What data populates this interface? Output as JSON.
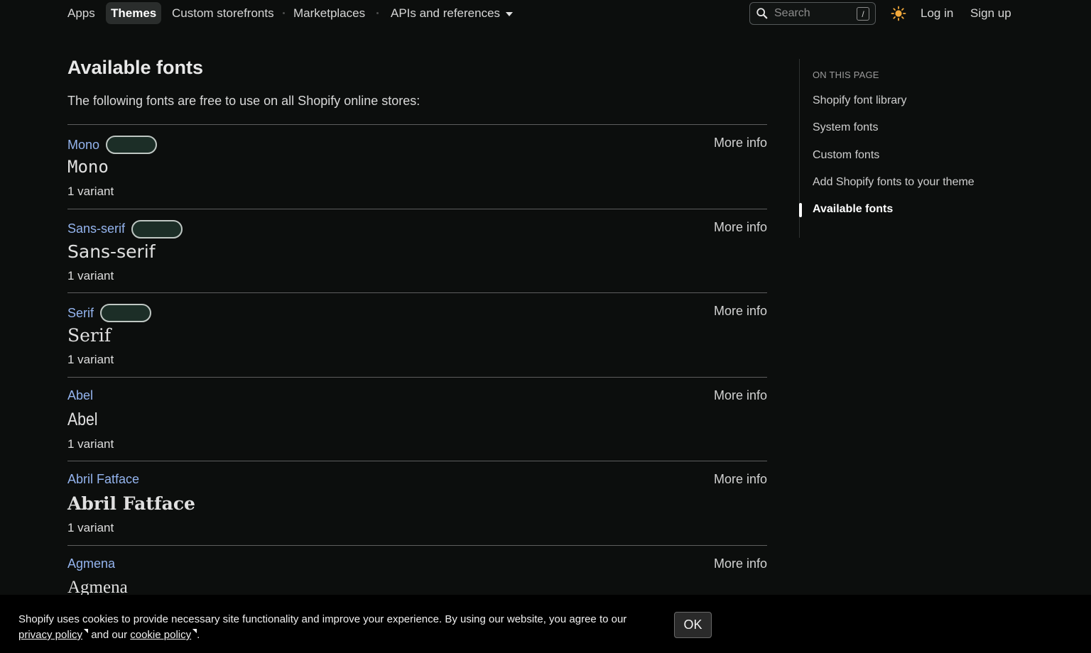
{
  "nav": {
    "items": [
      {
        "label": "Apps"
      },
      {
        "label": "Themes"
      },
      {
        "label": "Custom storefronts"
      },
      {
        "label": "Marketplaces"
      },
      {
        "label": "APIs and references"
      }
    ],
    "search_placeholder": "Search",
    "search_shortcut": "/",
    "login": "Log in",
    "signup": "Sign up"
  },
  "main": {
    "title": "Available fonts",
    "intro": "The following fonts are free to use on all Shopify online stores:",
    "more_info_label": "More info",
    "fonts": [
      {
        "name": "Mono",
        "sample": "Mono",
        "variants": "1 variant"
      },
      {
        "name": "Sans-serif",
        "sample": "Sans-serif",
        "variants": "1 variant"
      },
      {
        "name": "Serif",
        "sample": "Serif",
        "variants": "1 variant"
      },
      {
        "name": "Abel",
        "sample": "Abel",
        "variants": "1 variant"
      },
      {
        "name": "Abril Fatface",
        "sample": "Abril Fatface",
        "variants": "1 variant"
      },
      {
        "name": "Agmena",
        "sample": "Agmena",
        "variants": ""
      }
    ]
  },
  "toc": {
    "heading": "ON THIS PAGE",
    "items": [
      {
        "label": "Shopify font library"
      },
      {
        "label": "System fonts"
      },
      {
        "label": "Custom fonts"
      },
      {
        "label": "Add Shopify fonts to your theme"
      },
      {
        "label": "Available fonts"
      }
    ]
  },
  "cookie": {
    "text_before": "Shopify uses cookies to provide necessary site functionality and improve your experience. By using our website, you agree to our",
    "privacy_link": "privacy policy",
    "text_middle": " and our ",
    "cookie_link": "cookie policy",
    "text_end": ".",
    "ok": "OK"
  }
}
